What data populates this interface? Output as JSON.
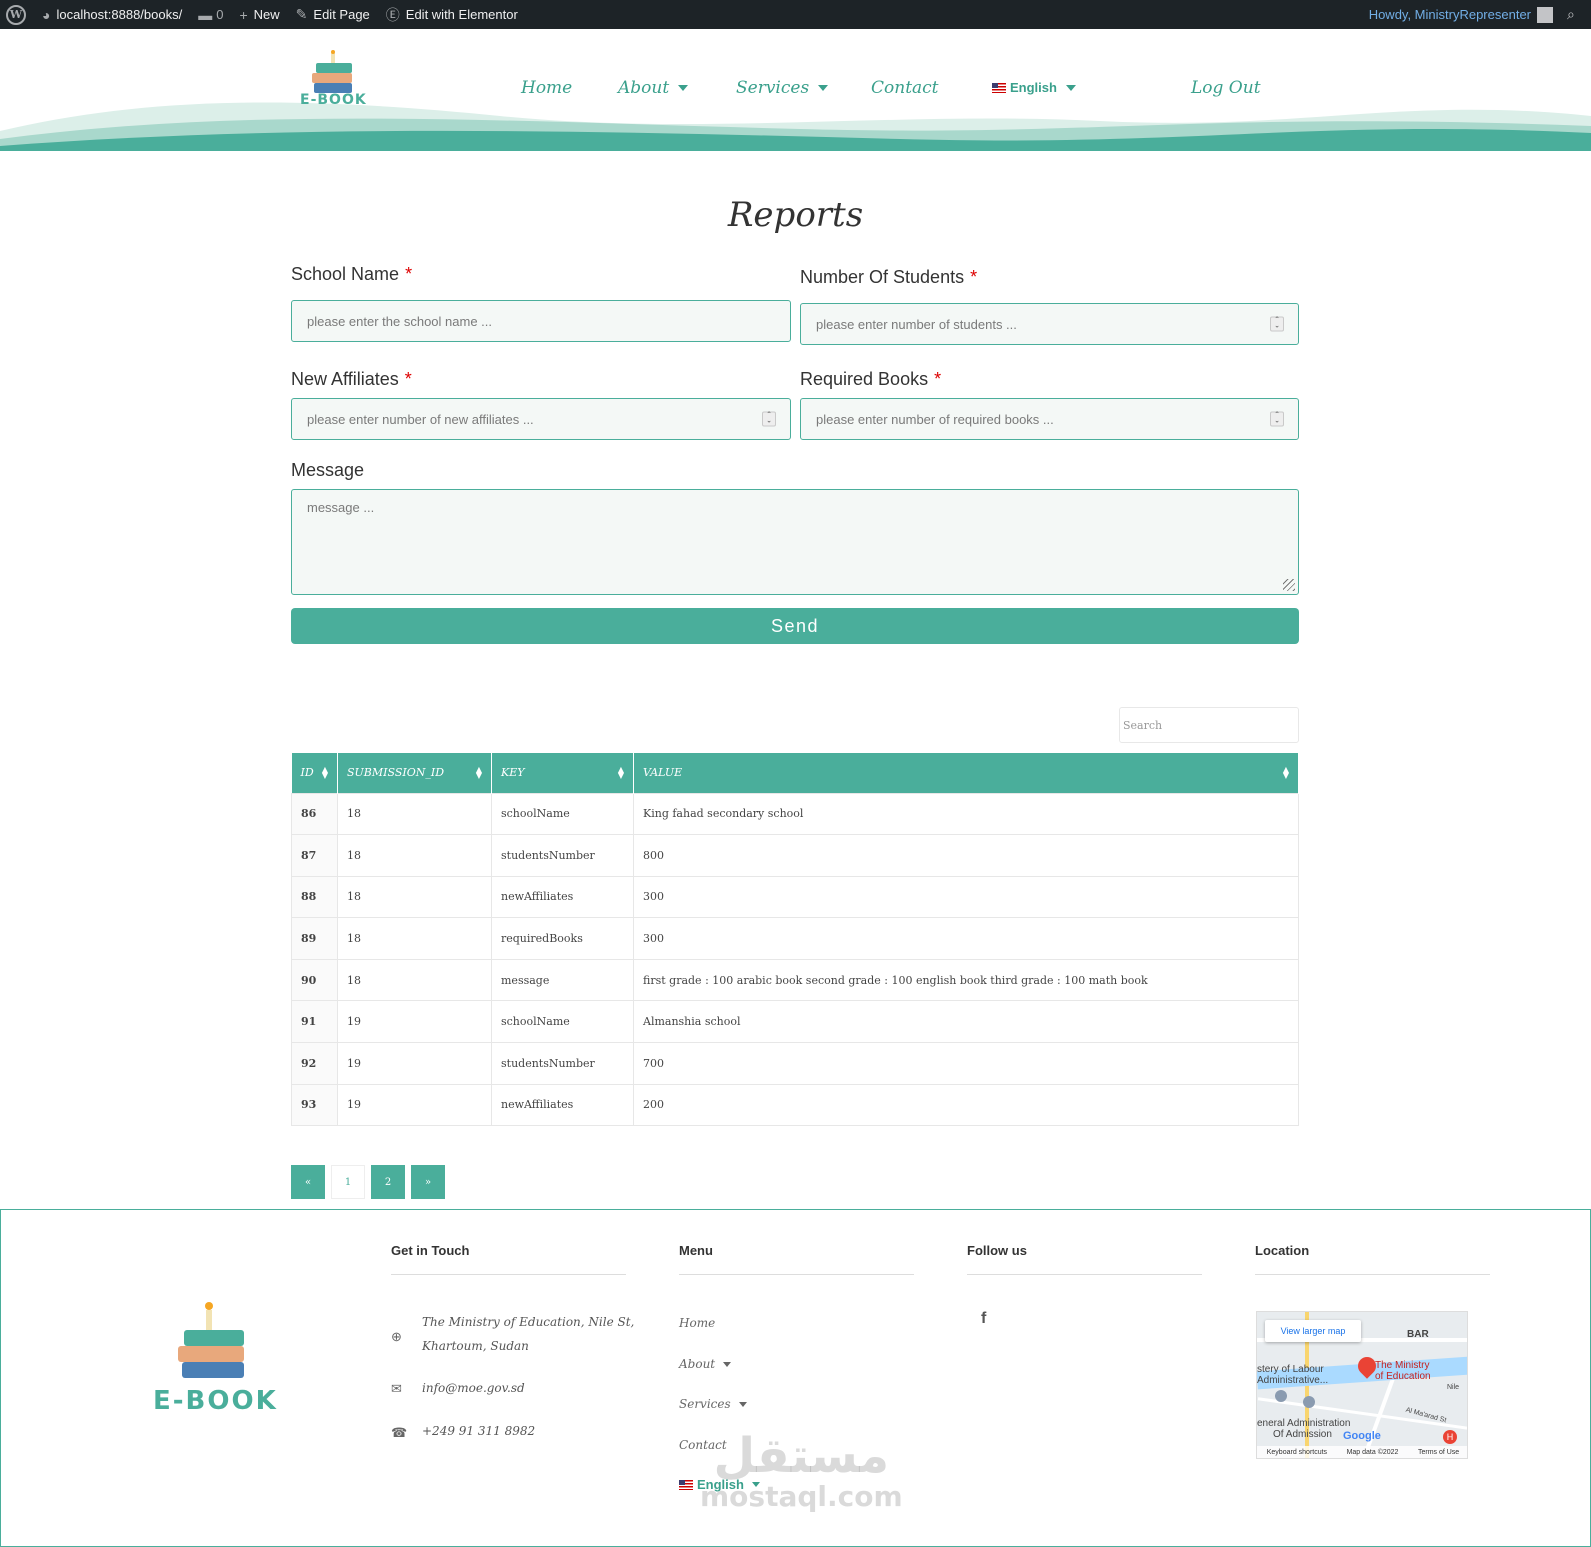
{
  "adminbar": {
    "url": "localhost:8888/books/",
    "comments_count": "0",
    "new_label": "New",
    "edit_page_label": "Edit Page",
    "elementor_label": "Edit with Elementor",
    "howdy": "Howdy, MinistryRepresenter"
  },
  "header": {
    "logo_text": "E-BOOK",
    "nav": [
      {
        "label": "Home"
      },
      {
        "label": "About"
      },
      {
        "label": "Services"
      },
      {
        "label": "Contact"
      },
      {
        "label": "English"
      },
      {
        "label": "Log Out"
      }
    ]
  },
  "page": {
    "title": "Reports"
  },
  "form": {
    "school_name": {
      "label": "School Name",
      "placeholder": "please enter the school name ..."
    },
    "students": {
      "label": "Number Of Students",
      "placeholder": "please enter number of students ..."
    },
    "affiliates": {
      "label": "New Affiliates",
      "placeholder": "please enter number of new affiliates ..."
    },
    "books": {
      "label": "Required Books",
      "placeholder": "please enter number of required books ..."
    },
    "message": {
      "label": "Message",
      "placeholder": "message ..."
    },
    "required_mark": "*",
    "send_label": "Send"
  },
  "table": {
    "search_placeholder": "Search",
    "headers": [
      "ID",
      "SUBMISSION_ID",
      "KEY",
      "VALUE"
    ],
    "rows": [
      {
        "id": "86",
        "submission": "18",
        "key": "schoolName",
        "value": "King fahad secondary school"
      },
      {
        "id": "87",
        "submission": "18",
        "key": "studentsNumber",
        "value": "800"
      },
      {
        "id": "88",
        "submission": "18",
        "key": "newAffiliates",
        "value": "300"
      },
      {
        "id": "89",
        "submission": "18",
        "key": "requiredBooks",
        "value": "300"
      },
      {
        "id": "90",
        "submission": "18",
        "key": "message",
        "value": "first grade : 100 arabic book second grade : 100 english book third grade : 100 math book"
      },
      {
        "id": "91",
        "submission": "19",
        "key": "schoolName",
        "value": "Almanshia school"
      },
      {
        "id": "92",
        "submission": "19",
        "key": "studentsNumber",
        "value": "700"
      },
      {
        "id": "93",
        "submission": "19",
        "key": "newAffiliates",
        "value": "200"
      }
    ]
  },
  "pagination": {
    "prev": "«",
    "pages": [
      "1",
      "2"
    ],
    "next": "»"
  },
  "footer": {
    "logo_text": "E-BOOK",
    "get_in_touch": {
      "title": "Get in Touch",
      "address_line1": "The Ministry of Education, Nile St,",
      "address_line2": "Khartoum, Sudan",
      "email": "info@moe.gov.sd",
      "phone": "+249 91 311 8982"
    },
    "menu": {
      "title": "Menu",
      "items": [
        "Home",
        "About",
        "Services",
        "Contact",
        "English"
      ]
    },
    "follow": {
      "title": "Follow us",
      "facebook": "f"
    },
    "location": {
      "title": "Location",
      "view_larger": "View larger map",
      "place_line1": "The Ministry",
      "place_line2": "of Education",
      "label_labour1": "stery of Labour",
      "label_labour2": "Administrative...",
      "label_admin1": "eneral Administration",
      "label_admin2": "Of Admission",
      "label_bar": "BAR",
      "label_nile": "Nile",
      "label_almaarad": "Al Ma'arad St",
      "google": "Google",
      "keyboard": "Keyboard shortcuts",
      "mapdata": "Map data ©2022",
      "terms": "Terms of Use"
    }
  },
  "watermark": {
    "ar": "مستقل",
    "en": "mostaql.com"
  },
  "colors": {
    "accent": "#4aae9b",
    "adminbar": "#1d2327"
  }
}
